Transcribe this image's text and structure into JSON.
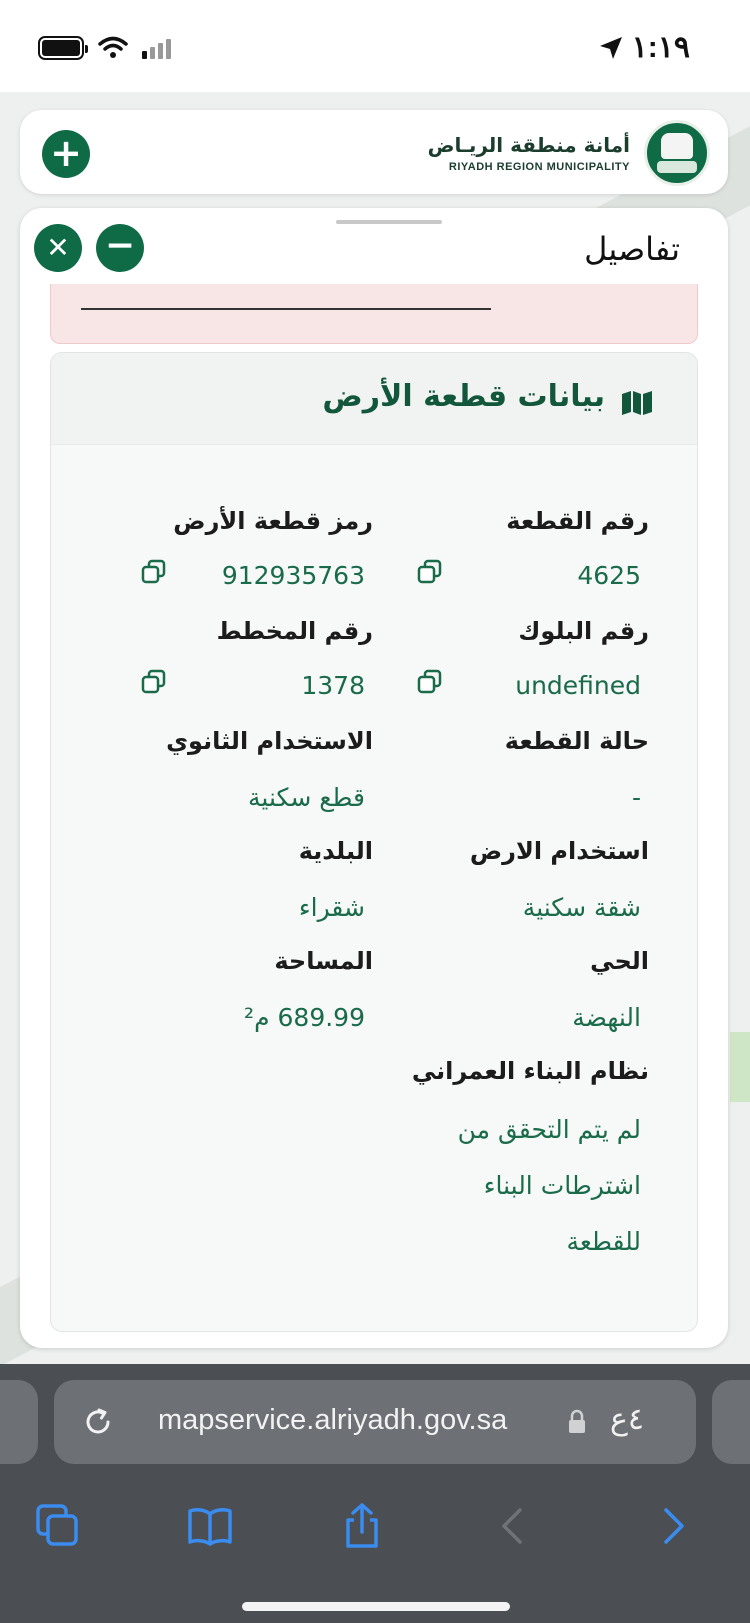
{
  "status_bar": {
    "time": "١:١٩"
  },
  "header": {
    "logo_ar": "أمانة منطقة الريـاض",
    "logo_en": "RIYADH REGION MUNICIPALITY"
  },
  "panel": {
    "title": "تفاصيل",
    "section_title": "بيانات قطعة الأرض",
    "fields": [
      {
        "label": "رقم القطعة",
        "value": "4625"
      },
      {
        "label": "رمز قطعة الأرض",
        "value": "912935763"
      },
      {
        "label": "رقم البلوك",
        "value": "undefined"
      },
      {
        "label": "رقم المخطط",
        "value": "1378"
      },
      {
        "label": "حالة القطعة",
        "value": "-"
      },
      {
        "label": "الاستخدام الثانوي",
        "value": "قطع سكنية"
      },
      {
        "label": "استخدام الارض",
        "value": "شقة سكنية"
      },
      {
        "label": "البلدية",
        "value": "شقراء"
      },
      {
        "label": "الحي",
        "value": "النهضة"
      },
      {
        "label": "المساحة",
        "value": "689.99 م²"
      },
      {
        "label": "نظام البناء العمراني",
        "value_lines": [
          "لم يتم التحقق من",
          "اشترطات البناء",
          "للقطعة"
        ]
      }
    ]
  },
  "browser": {
    "url": "mapservice.alriyadh.gov.sa",
    "text_size": "٤ع"
  },
  "colors": {
    "brand_green": "#0e6b45",
    "value_green": "#1a6b4a",
    "title_green": "#12573c"
  }
}
